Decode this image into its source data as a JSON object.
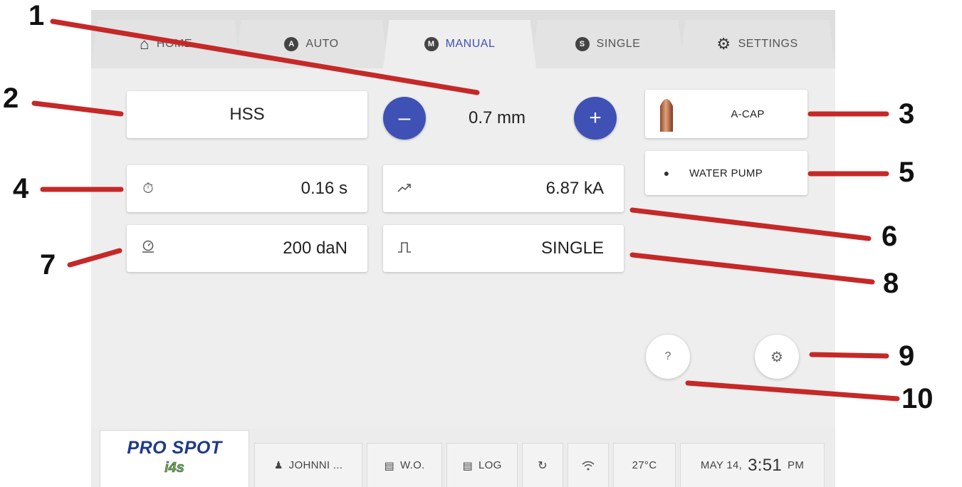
{
  "tabs": [
    {
      "label": "HOME",
      "icon": "home-icon",
      "active": false
    },
    {
      "label": "AUTO",
      "icon": "A",
      "active": false
    },
    {
      "label": "MANUAL",
      "icon": "M",
      "active": true
    },
    {
      "label": "SINGLE",
      "icon": "S",
      "active": false
    },
    {
      "label": "SETTINGS",
      "icon": "gear-icon",
      "active": false
    }
  ],
  "material": {
    "label": "HSS"
  },
  "thickness": {
    "value": "0.7 mm",
    "minus_label": "–",
    "plus_label": "+"
  },
  "cap": {
    "label": "A-CAP",
    "icon": "electrode-cap-icon"
  },
  "water_pump": {
    "label": "WATER PUMP",
    "icon": "water-drop-icon"
  },
  "params": {
    "time": {
      "value": "0.16 s",
      "icon": "stopwatch-icon"
    },
    "current": {
      "value": "6.87 kA",
      "icon": "trend-up-icon"
    },
    "force": {
      "value": "200 daN",
      "icon": "gauge-icon"
    },
    "pulse": {
      "value": "SINGLE",
      "icon": "pulse-icon"
    }
  },
  "fabs": {
    "help_label": "?",
    "settings_icon": "gear-icon"
  },
  "statusbar": {
    "logo_main": "PRO SPOT",
    "logo_sub": "i4s",
    "user": "JOHNNI ...",
    "work_order": "W.O.",
    "log": "LOG",
    "temperature": "27°C",
    "date": "MAY 14,",
    "time": "3:51",
    "ampm": "PM"
  },
  "callouts": [
    "1",
    "2",
    "3",
    "4",
    "5",
    "6",
    "7",
    "8",
    "9",
    "10"
  ],
  "colors": {
    "accent": "#3f51b5",
    "callout_line": "#c62828",
    "background": "#eeeeee"
  }
}
